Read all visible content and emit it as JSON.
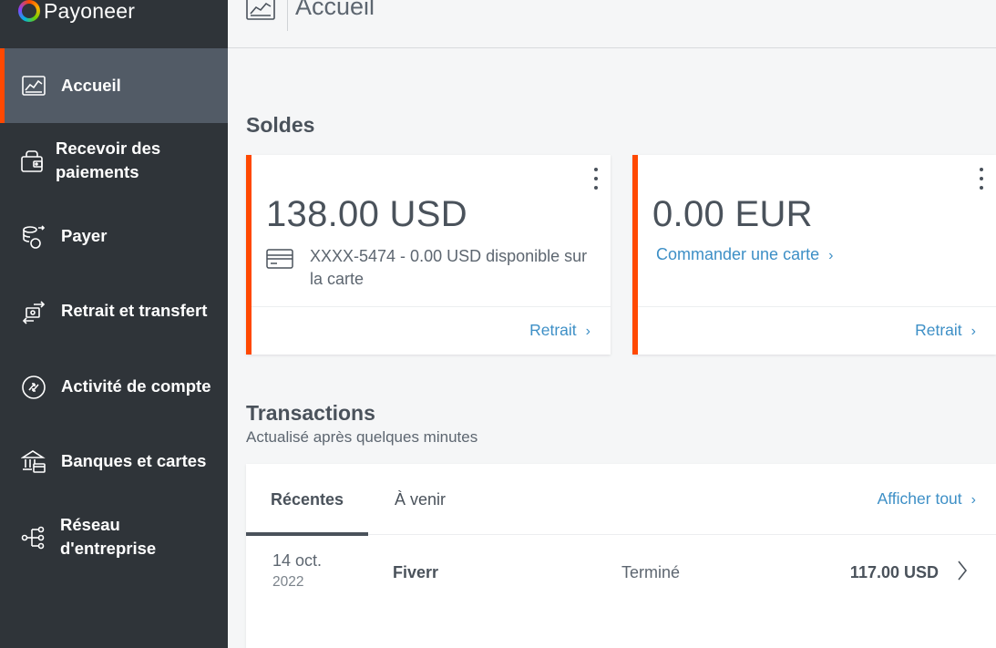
{
  "app": {
    "brand": "Payoneer"
  },
  "sidebar": {
    "items": [
      {
        "label": "Accueil",
        "icon": "chart-icon",
        "active": true
      },
      {
        "label": "Recevoir des paiements",
        "icon": "wallet-icon",
        "active": false
      },
      {
        "label": "Payer",
        "icon": "coins-icon",
        "active": false
      },
      {
        "label": "Retrait et transfert",
        "icon": "transfer-icon",
        "active": false
      },
      {
        "label": "Activité de compte",
        "icon": "activity-icon",
        "active": false
      },
      {
        "label": "Banques et cartes",
        "icon": "bank-icon",
        "active": false
      },
      {
        "label": "Réseau d'entreprise",
        "icon": "network-icon",
        "active": false
      }
    ],
    "accent_color": "#ff4800"
  },
  "header": {
    "title": "Accueil",
    "icon": "chart-icon"
  },
  "balances": {
    "title": "Soldes",
    "cards": [
      {
        "amount": "138.00 USD",
        "card_text": "XXXX-5474 - 0.00 USD disponible sur la carte",
        "withdraw_label": "Retrait"
      },
      {
        "amount": "0.00 EUR",
        "order_card_label": "Commander une carte",
        "withdraw_label": "Retrait"
      }
    ]
  },
  "transactions": {
    "title": "Transactions",
    "subtitle": "Actualisé après quelques minutes",
    "tabs": [
      {
        "label": "Récentes",
        "active": true
      },
      {
        "label": "À venir",
        "active": false
      }
    ],
    "show_all_label": "Afficher tout",
    "rows": [
      {
        "day": "14 oct.",
        "year": "2022",
        "name": "Fiverr",
        "status": "Terminé",
        "amount": "117.00 USD"
      }
    ]
  },
  "colors": {
    "link": "#3d8fc6",
    "sidebar_bg": "#2f3439",
    "active_bg": "#525b66"
  }
}
